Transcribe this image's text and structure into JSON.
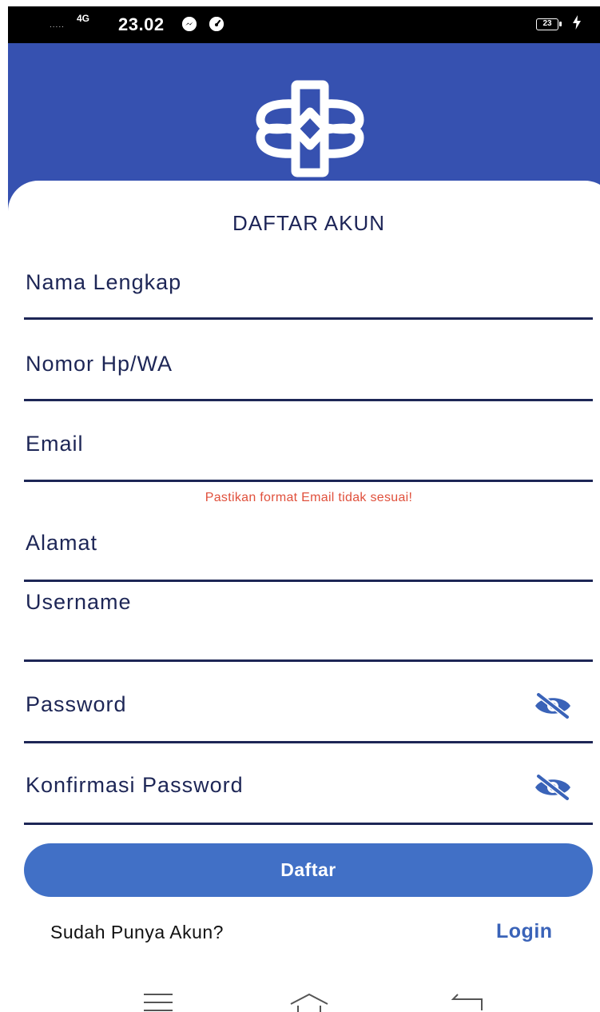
{
  "status_bar": {
    "signal": ".....",
    "network": "4G",
    "time": "23.02",
    "battery": "23",
    "icons": [
      "messenger-icon",
      "gauge-icon",
      "battery-icon",
      "charging-icon"
    ]
  },
  "header": {
    "background": "#3651b0",
    "logo_icon": "ornament-logo-icon"
  },
  "form": {
    "title": "DAFTAR AKUN",
    "fields": {
      "nama": "Nama Lengkap",
      "nomor": "Nomor Hp/WA",
      "email": "Email",
      "alamat": "Alamat",
      "username": "Username",
      "password": "Password",
      "konfirmasi": "Konfirmasi Password"
    },
    "email_error": "Pastikan format Email tidak sesuai!",
    "submit_label": "Daftar",
    "have_account_text": "Sudah Punya Akun?",
    "login_label": "Login"
  },
  "colors": {
    "primary": "#3651b0",
    "button": "#4170c6",
    "text_dark": "#1d2656",
    "error": "#e0503c",
    "link": "#3a63b8"
  },
  "nav_bar": {
    "icons": [
      "menu-icon",
      "home-icon",
      "back-icon"
    ]
  }
}
